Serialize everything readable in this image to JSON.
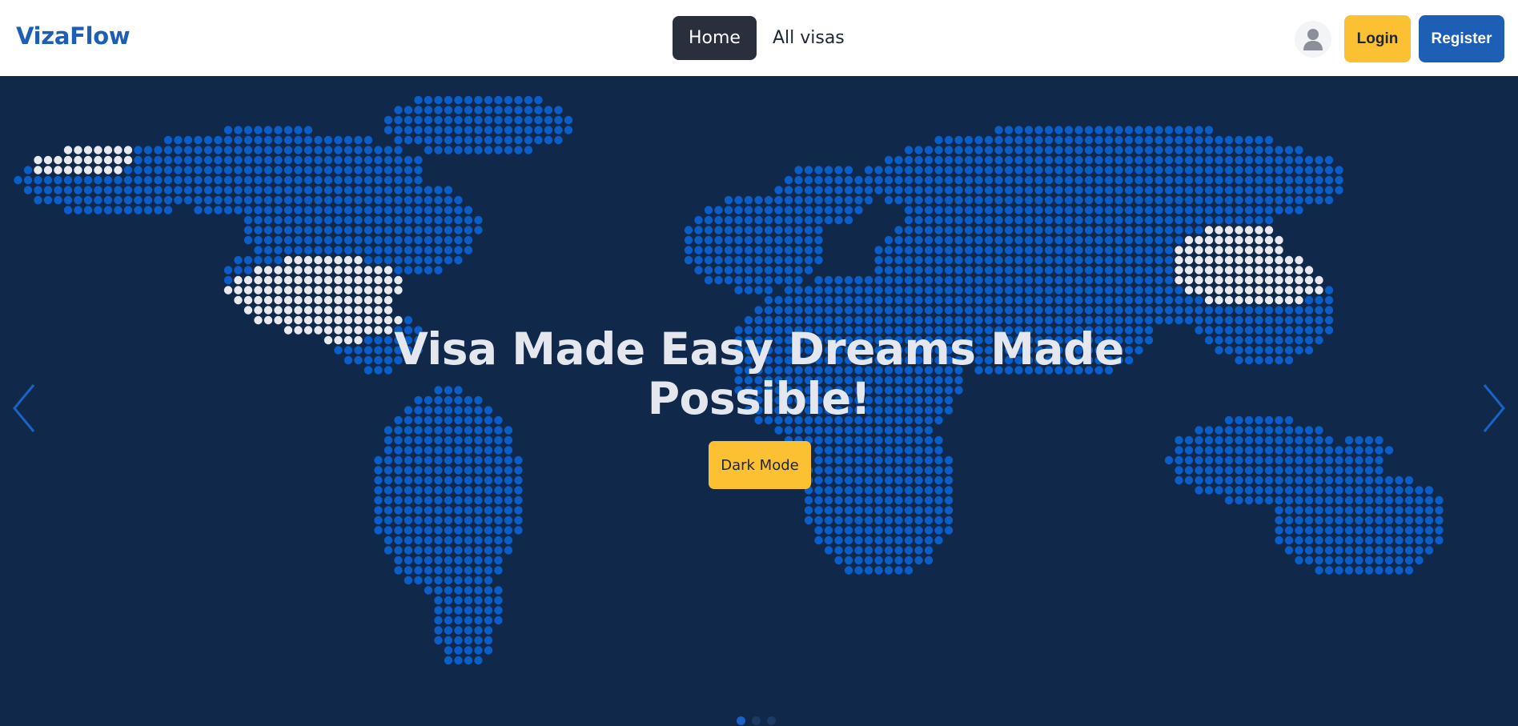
{
  "brand": "VizaFlow",
  "nav": {
    "items": [
      {
        "label": "Home",
        "active": true
      },
      {
        "label": "All visas",
        "active": false
      }
    ]
  },
  "auth": {
    "login_label": "Login",
    "register_label": "Register"
  },
  "hero": {
    "title_line1": "Visa Made Easy Dreams Made",
    "title_line2": "Possible!",
    "cta_label": "Dark Mode",
    "slides_count": 3,
    "active_slide": 0
  },
  "icons": {
    "avatar": "user-icon",
    "prev": "chevron-left-icon",
    "next": "chevron-right-icon"
  },
  "colors": {
    "brand": "#1d5fb5",
    "accent": "#fbc132",
    "hero_bg": "#10284a",
    "map_dot": "#0b5ec8",
    "highlight_dot": "#e8eaef"
  }
}
